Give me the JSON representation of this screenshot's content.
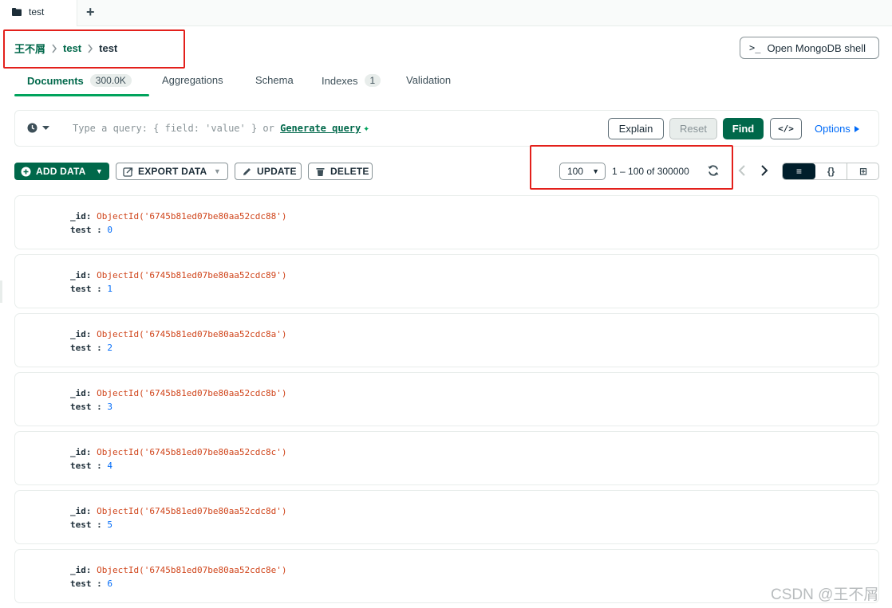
{
  "tab": {
    "label": "test",
    "icon": "folder-icon"
  },
  "breadcrumb": {
    "root": "王不屑",
    "database": "test",
    "collection": "test"
  },
  "shell_button": {
    "prompt": ">_",
    "label": "Open MongoDB shell"
  },
  "subtabs": [
    {
      "label": "Documents",
      "count": "300.0K"
    },
    {
      "label": "Aggregations"
    },
    {
      "label": "Schema"
    },
    {
      "label": "Indexes",
      "count": "1"
    },
    {
      "label": "Validation"
    }
  ],
  "query": {
    "placeholder": "Type a query: { field: 'value' } or",
    "generate_label": "Generate query",
    "explain": "Explain",
    "reset": "Reset",
    "find": "Find",
    "code": "</>",
    "options": "Options"
  },
  "toolbar": {
    "add_data": "ADD DATA",
    "export_data": "EXPORT DATA",
    "update": "UPDATE",
    "delete": "DELETE"
  },
  "pagination": {
    "page_size": "100",
    "range": "1 – 100 of 300000"
  },
  "view_toggle": {
    "list": "≡",
    "json": "{}",
    "table": "⊞"
  },
  "documents": [
    {
      "id_key": "_id:",
      "id_value": "ObjectId('6745b81ed07be80aa52cdc88')",
      "field_key": "test :",
      "field_value": "0"
    },
    {
      "id_key": "_id:",
      "id_value": "ObjectId('6745b81ed07be80aa52cdc89')",
      "field_key": "test :",
      "field_value": "1"
    },
    {
      "id_key": "_id:",
      "id_value": "ObjectId('6745b81ed07be80aa52cdc8a')",
      "field_key": "test :",
      "field_value": "2"
    },
    {
      "id_key": "_id:",
      "id_value": "ObjectId('6745b81ed07be80aa52cdc8b')",
      "field_key": "test :",
      "field_value": "3"
    },
    {
      "id_key": "_id:",
      "id_value": "ObjectId('6745b81ed07be80aa52cdc8c')",
      "field_key": "test :",
      "field_value": "4"
    },
    {
      "id_key": "_id:",
      "id_value": "ObjectId('6745b81ed07be80aa52cdc8d')",
      "field_key": "test :",
      "field_value": "5"
    },
    {
      "id_key": "_id:",
      "id_value": "ObjectId('6745b81ed07be80aa52cdc8e')",
      "field_key": "test :",
      "field_value": "6"
    }
  ],
  "watermark": "CSDN @王不屑",
  "colors": {
    "brand": "#00684a",
    "accent": "#00a35c",
    "link": "#016bf8",
    "objectid": "#d0451b",
    "highlight_box": "#e3201b"
  }
}
